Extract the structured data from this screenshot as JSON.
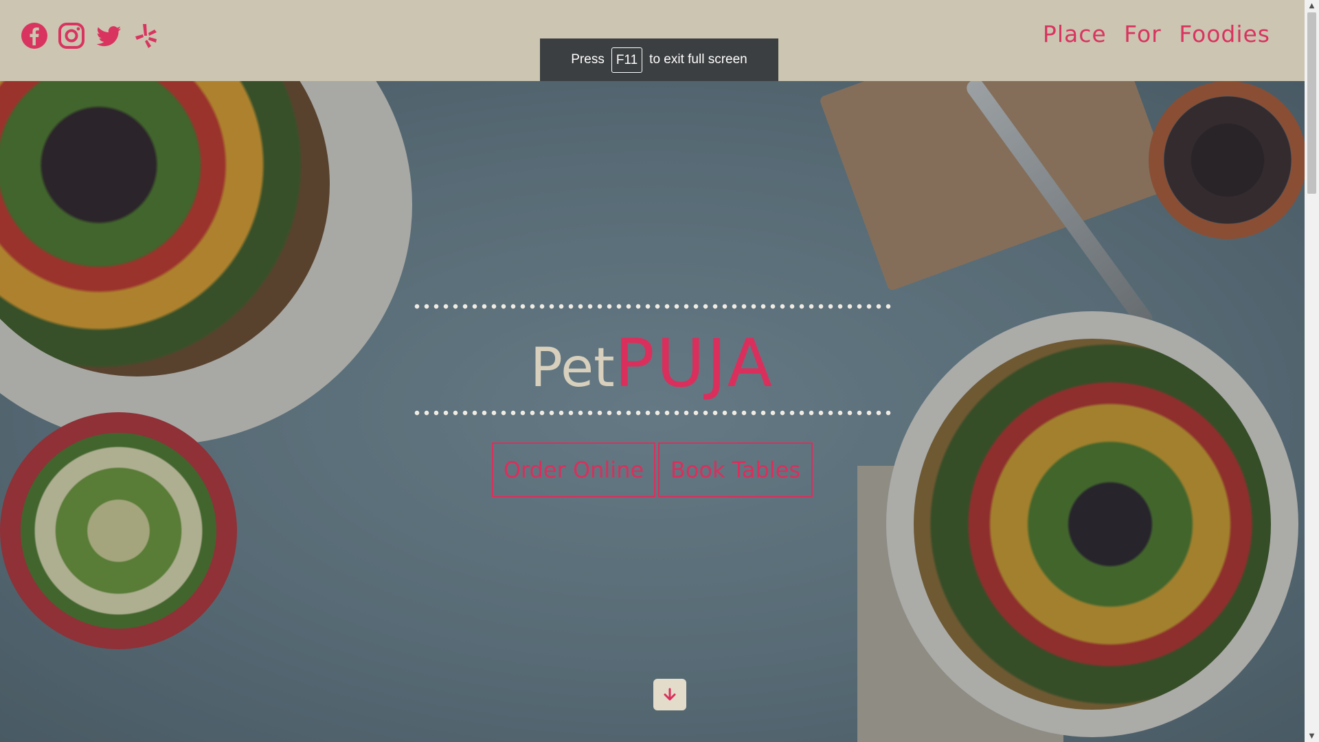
{
  "header": {
    "social_icons": [
      "facebook-icon",
      "instagram-icon",
      "twitter-icon",
      "yelp-icon"
    ],
    "tagline": "Place For Foodies"
  },
  "fullscreen_toast": {
    "before_key": "Press",
    "key": "F11",
    "after_key": "to exit full screen"
  },
  "hero": {
    "brand_prefix": "Pet",
    "brand_name": "PUJA",
    "buttons": {
      "order": "Order Online",
      "book": "Book Tables"
    },
    "scroll_icon": "arrow-down-icon"
  },
  "colors": {
    "accent": "#da2f5c",
    "header_bg": "#ccc5b1",
    "brand_prefix": "#d8d0bd",
    "toast_bg": "#3c3f41"
  }
}
